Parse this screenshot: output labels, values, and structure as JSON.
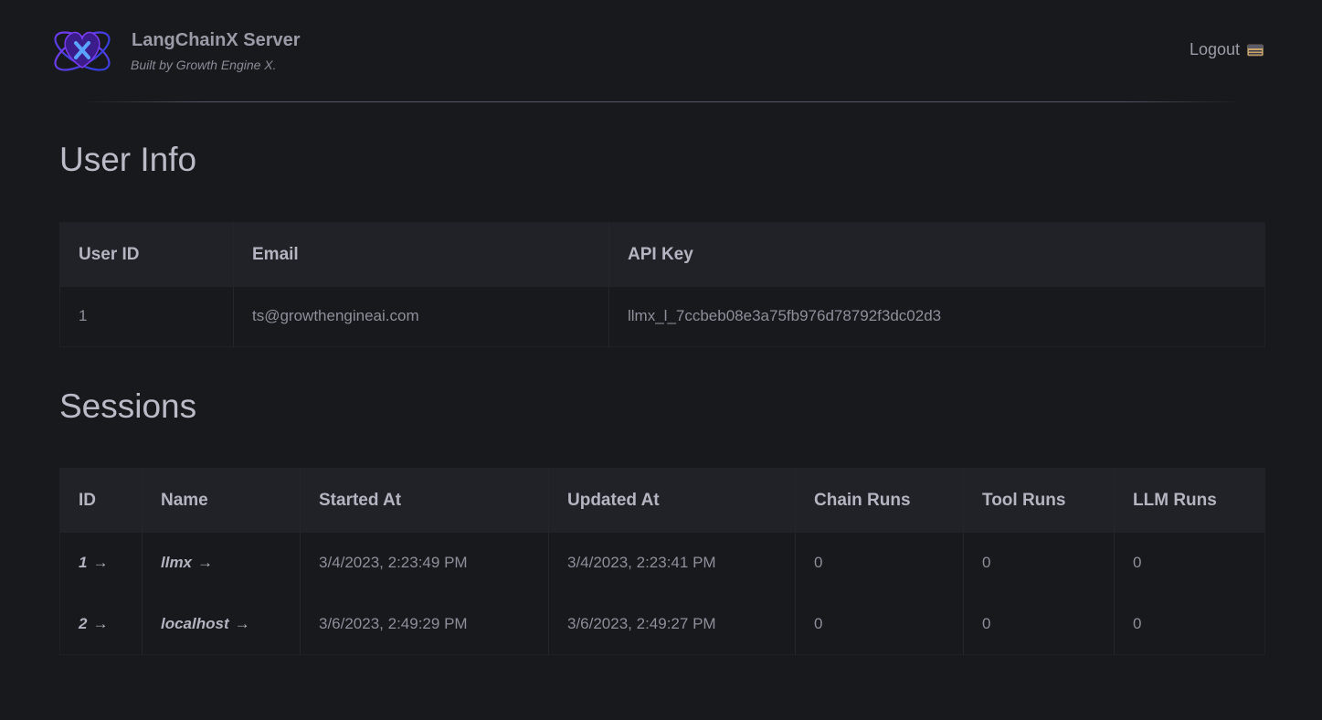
{
  "header": {
    "title": "LangChainX Server",
    "subtitle": "Built by Growth Engine X.",
    "logout_label": "Logout"
  },
  "user_info": {
    "heading": "User Info",
    "columns": [
      "User ID",
      "Email",
      "API Key"
    ],
    "row": {
      "user_id": "1",
      "email": "ts@growthengineai.com",
      "api_key": "llmx_l_7ccbeb08e3a75fb976d78792f3dc02d3"
    }
  },
  "sessions": {
    "heading": "Sessions",
    "columns": [
      "ID",
      "Name",
      "Started At",
      "Updated At",
      "Chain Runs",
      "Tool Runs",
      "LLM Runs"
    ],
    "rows": [
      {
        "id": "1",
        "name": "llmx",
        "started_at": "3/4/2023, 2:23:49 PM",
        "updated_at": "3/4/2023, 2:23:41 PM",
        "chain_runs": "0",
        "tool_runs": "0",
        "llm_runs": "0"
      },
      {
        "id": "2",
        "name": "localhost",
        "started_at": "3/6/2023, 2:49:29 PM",
        "updated_at": "3/6/2023, 2:49:27 PM",
        "chain_runs": "0",
        "tool_runs": "0",
        "llm_runs": "0"
      }
    ],
    "arrow": "→"
  },
  "icons": {
    "logo": "atom-x-logo-icon",
    "logout": "file-cabinet-icon"
  },
  "colors": {
    "background": "#18191d",
    "header_row": "#212227",
    "logo_accent": "#6b3bea"
  }
}
